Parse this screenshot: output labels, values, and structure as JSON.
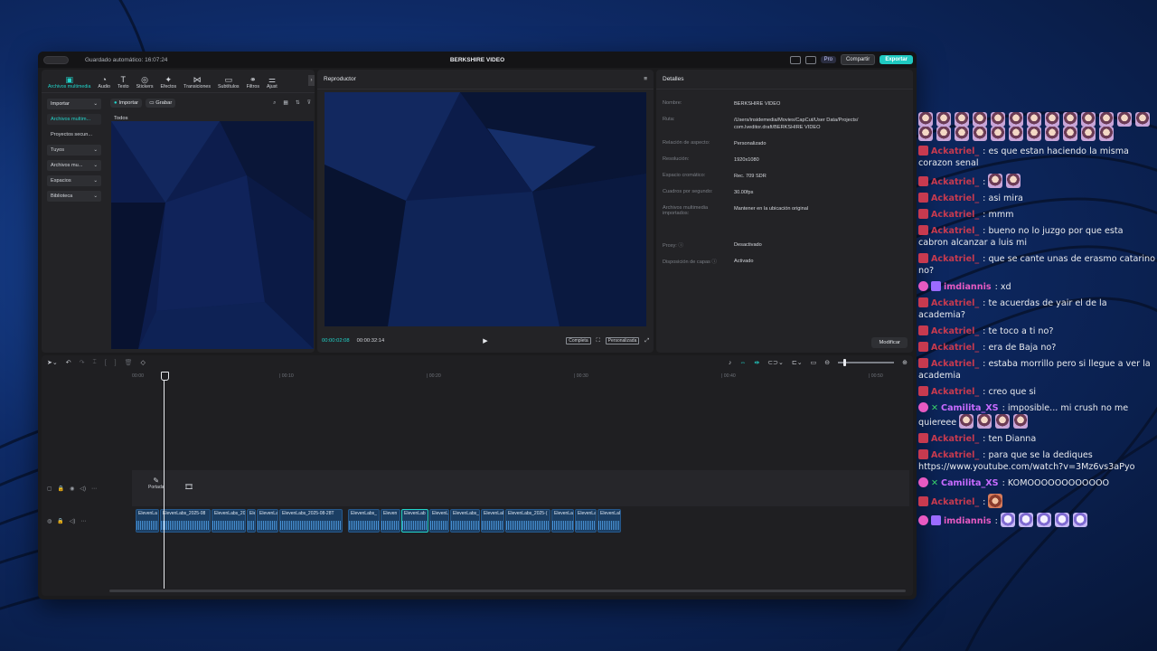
{
  "titlebar": {
    "autosave": "Guardado automático: 16:07:24",
    "title": "BERKSHIRE VIDEO",
    "pro": "Pro",
    "share": "Compartir",
    "export": "Exportar"
  },
  "tool_tabs": [
    {
      "icon": "▣",
      "label": "Archivos multimedia"
    },
    {
      "icon": "◔",
      "label": "Audio"
    },
    {
      "icon": "T",
      "label": "Texto"
    },
    {
      "icon": "◎",
      "label": "Stickers"
    },
    {
      "icon": "✦",
      "label": "Efectos"
    },
    {
      "icon": "⋈",
      "label": "Transiciones"
    },
    {
      "icon": "▭",
      "label": "Subtítulos"
    },
    {
      "icon": "⚭",
      "label": "Filtros"
    },
    {
      "icon": "⚌",
      "label": "Ajust"
    }
  ],
  "side_nav": {
    "importar": "Importar",
    "archivos_multim": "Archivos multim...",
    "proyectos": "Proyectos secun...",
    "tuyos": "Tuyos",
    "archivos_mu": "Archivos mu...",
    "espacios": "Espacios",
    "biblioteca": "Biblioteca"
  },
  "media": {
    "import_btn": "Importar",
    "record_btn": "Grabar",
    "filter_all": "Todos"
  },
  "player": {
    "title": "Reproductor",
    "current_time": "00:00:02:08",
    "total_time": "00:00:32:14",
    "complete": "Completa",
    "custom": "Personalizada"
  },
  "details": {
    "title": "Detalles",
    "rows": [
      {
        "k": "Nombre:",
        "v": "BERKSHIRE VIDEO"
      },
      {
        "k": "Ruta:",
        "v": "/Users/insidemedia/Movies/CapCut/User Data/Projects/ com.lveditor.draft/BERKSHIRE VIDEO"
      },
      {
        "k": "Relación de aspecto:",
        "v": "Personalizado"
      },
      {
        "k": "Resolución:",
        "v": "1920x1080"
      },
      {
        "k": "Espacio cromático:",
        "v": "Rec. 709 SDR"
      },
      {
        "k": "Cuadros por segundo:",
        "v": "30.00fps"
      },
      {
        "k": "Archivos multimedia importados:",
        "v": "Mantener en la ubicación original"
      },
      {
        "k": "Proxy: ⓘ",
        "v": "Desactivado"
      },
      {
        "k": "Disposición de capas ⓘ",
        "v": "Activado"
      }
    ],
    "modify_btn": "Modificar"
  },
  "timeline": {
    "ruler": [
      "00:00",
      "00:10",
      "00:20",
      "00:30",
      "00:40",
      "00:50"
    ],
    "cover_label": "Portada",
    "clips": [
      {
        "label": "ElevenLa"
      },
      {
        "label": "ElevenLabs_2025-08"
      },
      {
        "label": "ElevenLabs_20"
      },
      {
        "label": "Ele"
      },
      {
        "label": "ElevenLa"
      },
      {
        "label": "ElevenLabs_2025-08-28T"
      },
      {
        "label": "ElevenLabs_"
      },
      {
        "label": "Eleven"
      },
      {
        "label": "ElevenLab"
      },
      {
        "label": "ElevenL"
      },
      {
        "label": "ElevenLabs_"
      },
      {
        "label": "ElevenLal"
      },
      {
        "label": "ElevenLabs_2025-("
      },
      {
        "label": "ElevenLa"
      },
      {
        "label": "ElevenLa"
      },
      {
        "label": "ElevenLal"
      }
    ]
  },
  "chat": [
    {
      "user": "",
      "text": "",
      "emotes": 24
    },
    {
      "user": "Ackatriel_",
      "color": "#c73a4f",
      "text": "es que estan haciendo la misma corazon senal"
    },
    {
      "user": "Ackatriel_",
      "color": "#c73a4f",
      "text": "",
      "emotes": 2
    },
    {
      "user": "Ackatriel_",
      "color": "#c73a4f",
      "text": "asi mira"
    },
    {
      "user": "Ackatriel_",
      "color": "#c73a4f",
      "text": "mmm"
    },
    {
      "user": "Ackatriel_",
      "color": "#c73a4f",
      "text": "bueno no lo juzgo por que esta cabron alcanzar a luis mi"
    },
    {
      "user": "Ackatriel_",
      "color": "#c73a4f",
      "text": "que se cante unas de erasmo catarino no?"
    },
    {
      "user": "imdiannis",
      "color": "#e75ac2",
      "text": "xd"
    },
    {
      "user": "Ackatriel_",
      "color": "#c73a4f",
      "text": "te acuerdas de yair el de la academia?"
    },
    {
      "user": "Ackatriel_",
      "color": "#c73a4f",
      "text": "te toco a ti no?"
    },
    {
      "user": "Ackatriel_",
      "color": "#c73a4f",
      "text": "era de Baja no?"
    },
    {
      "user": "Ackatriel_",
      "color": "#c73a4f",
      "text": "estaba morrillo pero si llegue a ver la academia"
    },
    {
      "user": "Ackatriel_",
      "color": "#c73a4f",
      "text": "creo que si"
    },
    {
      "user": "Camilita_XS",
      "color": "#c86bff",
      "text": "imposible... mi crush no me quiereee",
      "emotes": 4
    },
    {
      "user": "Ackatriel_",
      "color": "#c73a4f",
      "text": "ten Dianna"
    },
    {
      "user": "Ackatriel_",
      "color": "#c73a4f",
      "text": "para que se la dediques https://www.youtube.com/watch?v=3Mz6vs3aPyo"
    },
    {
      "user": "Camilita_XS",
      "color": "#c86bff",
      "text": "KOMOOOOOOOOOOOO"
    },
    {
      "user": "Ackatriel_",
      "color": "#c73a4f",
      "text": "",
      "emotes": 1
    },
    {
      "user": "imdiannis",
      "color": "#e75ac2",
      "text": "",
      "emotes": 5
    }
  ]
}
